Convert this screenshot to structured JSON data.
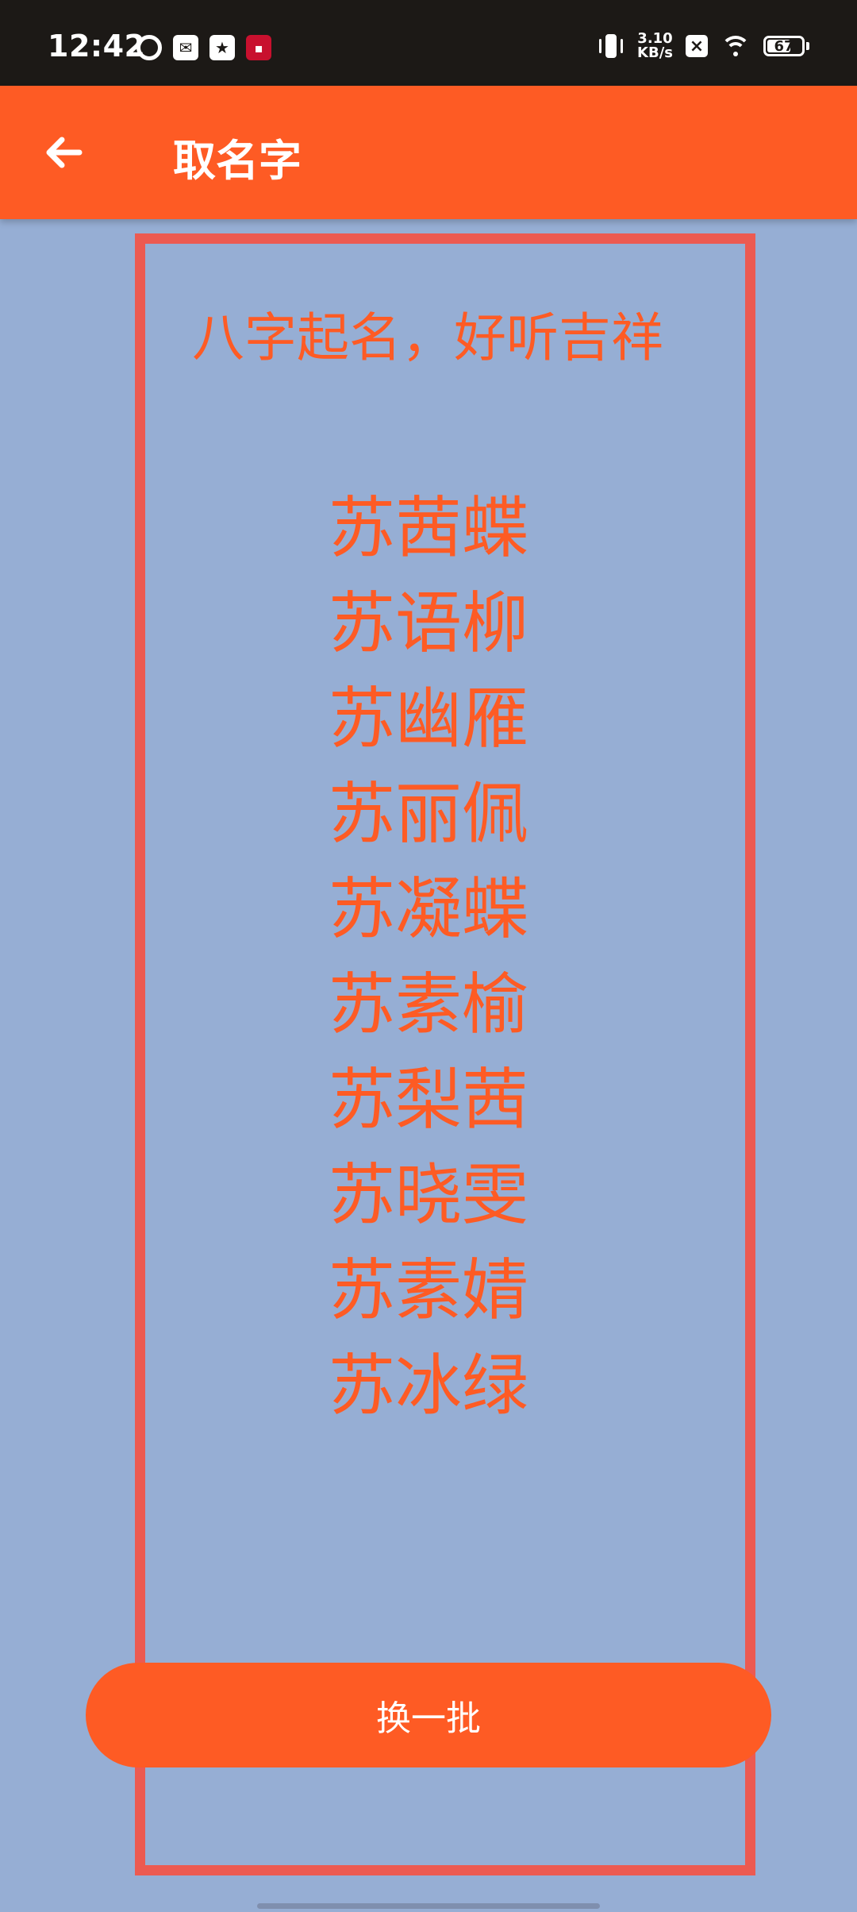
{
  "status_bar": {
    "time": "12:42",
    "net_speed_value": "3.10",
    "net_speed_unit": "KB/s",
    "battery_level": "67",
    "icons": [
      "ring-icon",
      "message-icon",
      "star-icon",
      "app-icon",
      "vibrate-icon",
      "close-icon",
      "wifi-icon",
      "battery-icon"
    ]
  },
  "app_bar": {
    "title": "取名字",
    "back_icon": "arrow-left-icon"
  },
  "content": {
    "headline": "八字起名，好听吉祥",
    "names": [
      "苏茜蝶",
      "苏语柳",
      "苏幽雁",
      "苏丽佩",
      "苏凝蝶",
      "苏素榆",
      "苏梨茜",
      "苏晓雯",
      "苏素婧",
      "苏冰绿"
    ]
  },
  "actions": {
    "refresh_label": "换一批"
  },
  "colors": {
    "accent": "#fe5b24",
    "background": "#96aed4",
    "frame": "#ec5a51",
    "status_bar": "#1c1916"
  }
}
